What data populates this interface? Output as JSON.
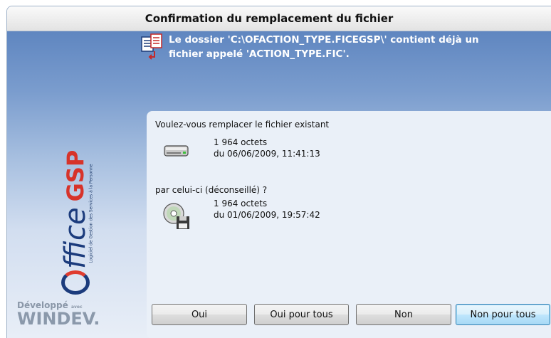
{
  "dialog": {
    "title": "Confirmation du remplacement du fichier",
    "message_line1": "Le dossier 'C:\\OFACTION_TYPE.FICEGSP\\' contient déjà un",
    "message_line2": "fichier appelé 'ACTION_TYPE.FIC'."
  },
  "branding": {
    "product_o": "O",
    "product_ffice": "ffice",
    "product_gsp": "GSP",
    "product_tagline": "Logiciel de Gestion des Services à la Personne",
    "windev_small": "Développé",
    "windev_avec": "avec",
    "windev_big": "WINDEV."
  },
  "existing": {
    "question": "Voulez-vous remplacer le fichier existant",
    "size": "1 964 octets",
    "date": "du 06/06/2009, 11:41:13",
    "icon": "hard-drive-icon"
  },
  "replacement": {
    "question": "par celui-ci (déconseillé) ?",
    "size": "1 964 octets",
    "date": "du 01/06/2009, 19:57:42",
    "icon": "cd-floppy-icon"
  },
  "buttons": {
    "yes": "Oui",
    "yes_all": "Oui pour tous",
    "no": "Non",
    "no_all": "Non pour tous"
  },
  "colors": {
    "header_blue": "#5f86c0",
    "logo_blue": "#1b3b7c",
    "logo_red": "#d7332a",
    "default_button": "#bee6fd"
  }
}
